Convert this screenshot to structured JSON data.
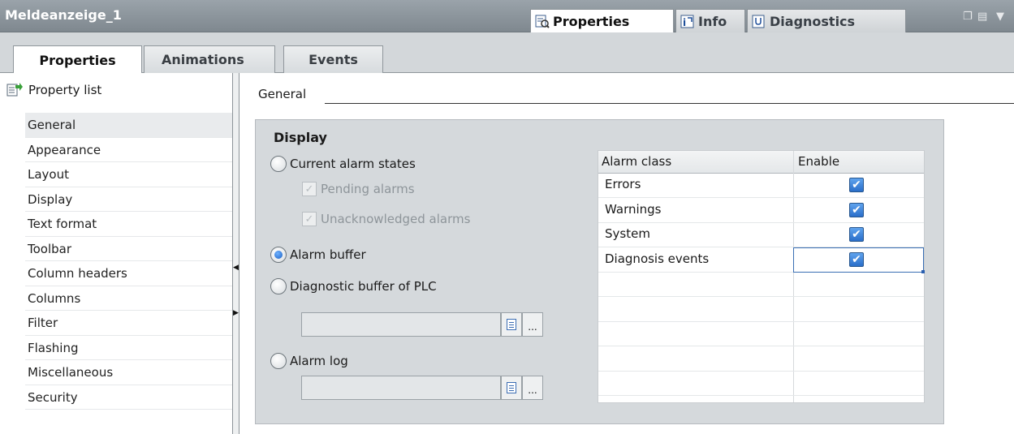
{
  "titlebar": {
    "title": "Meldeanzeige_1",
    "tabs": [
      {
        "label": "Properties",
        "icon": "properties-inspector-icon",
        "active": true
      },
      {
        "label": "Info",
        "icon": "info-icon",
        "active": false
      },
      {
        "label": "Diagnostics",
        "icon": "diagnostics-icon",
        "active": false
      }
    ],
    "controls": {
      "restore": "❐",
      "menu": "▤",
      "dropdown": "▼"
    }
  },
  "main_tabs": [
    {
      "label": "Properties",
      "active": true
    },
    {
      "label": "Animations",
      "active": false
    },
    {
      "label": "Events",
      "active": false
    }
  ],
  "sidebar": {
    "header": "Property list",
    "items": [
      {
        "label": "General",
        "selected": true
      },
      {
        "label": "Appearance"
      },
      {
        "label": "Layout"
      },
      {
        "label": "Display"
      },
      {
        "label": "Text format"
      },
      {
        "label": "Toolbar"
      },
      {
        "label": "Column headers"
      },
      {
        "label": "Columns"
      },
      {
        "label": "Filter"
      },
      {
        "label": "Flashing"
      },
      {
        "label": "Miscellaneous"
      },
      {
        "label": "Security"
      }
    ]
  },
  "content": {
    "section_title": "General",
    "group_title": "Display",
    "options": {
      "current_alarm_states": {
        "label": "Current alarm states",
        "selected": false
      },
      "pending_alarms": {
        "label": "Pending alarms",
        "checked": true,
        "enabled": false
      },
      "unacknowledged_alarms": {
        "label": "Unacknowledged alarms",
        "checked": true,
        "enabled": false
      },
      "alarm_buffer": {
        "label": "Alarm buffer",
        "selected": true
      },
      "diagnostic_buffer": {
        "label": "Diagnostic buffer of PLC",
        "selected": false,
        "value": "",
        "dots_label": "..."
      },
      "alarm_log": {
        "label": "Alarm log",
        "selected": false,
        "value": "",
        "dots_label": "..."
      }
    },
    "alarm_table": {
      "columns": [
        "Alarm class",
        "Enable"
      ],
      "rows": [
        {
          "name": "Errors",
          "enabled": true
        },
        {
          "name": "Warnings",
          "enabled": true
        },
        {
          "name": "System",
          "enabled": true
        },
        {
          "name": "Diagnosis events",
          "enabled": true
        }
      ],
      "check_glyph": "✔"
    }
  },
  "colors": {
    "accent": "#2a6ec9",
    "titlebar": "#8a939a",
    "panel": "#d5d9dc"
  }
}
